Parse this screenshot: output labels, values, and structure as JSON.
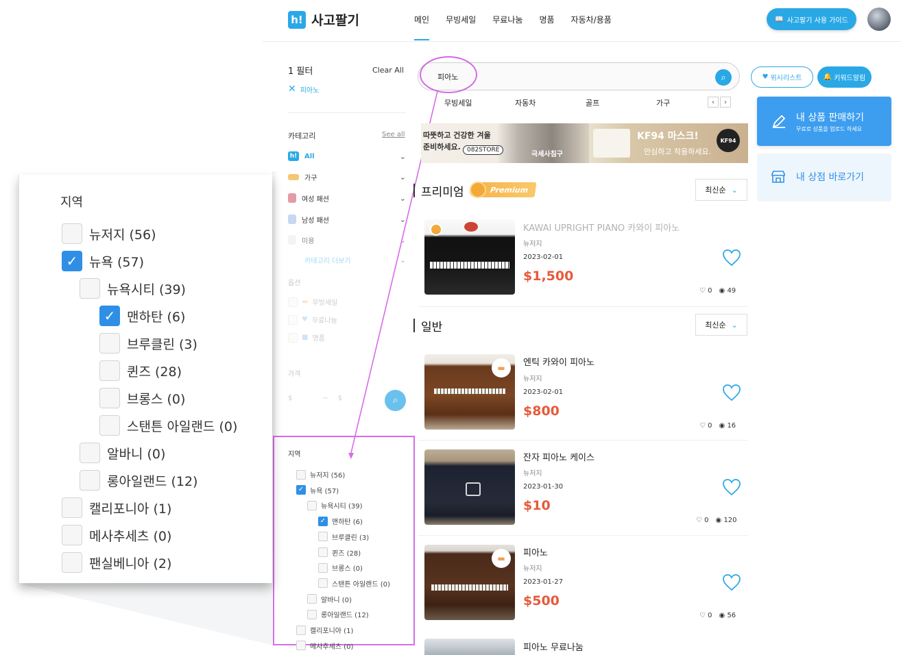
{
  "header": {
    "logo_mark": "h!",
    "logo_text": "사고팔기",
    "nav": [
      "메인",
      "무빙세일",
      "무료나눔",
      "명품",
      "자동차/용품"
    ],
    "guide_button": "사고팔기 사용 가이드",
    "accent": "#2aa8e6"
  },
  "filter": {
    "count_label": "1 필터",
    "clear_all": "Clear All",
    "active_tag": "피아노",
    "category_title": "카테고리",
    "see_all": "See all",
    "categories": [
      "All",
      "가구",
      "여성 패션",
      "남성 패션",
      "미용",
      "카테고리 더보기"
    ],
    "option_title": "옵션",
    "options": [
      "무빙세일",
      "무료나눔",
      "명품"
    ],
    "price_title": "가격",
    "price_min": "$",
    "price_sep": "~",
    "price_max": "$",
    "region_title": "지역",
    "regions": [
      {
        "label": "뉴저지 (56)",
        "checked": false,
        "level": 0
      },
      {
        "label": "뉴욕 (57)",
        "checked": true,
        "level": 0
      },
      {
        "label": "뉴욕시티 (39)",
        "checked": false,
        "level": 1
      },
      {
        "label": "맨하탄 (6)",
        "checked": true,
        "level": 2
      },
      {
        "label": "브루클린 (3)",
        "checked": false,
        "level": 2
      },
      {
        "label": "퀸즈 (28)",
        "checked": false,
        "level": 2
      },
      {
        "label": "브롱스 (0)",
        "checked": false,
        "level": 2
      },
      {
        "label": "스탠튼 아일랜드 (0)",
        "checked": false,
        "level": 2
      },
      {
        "label": "알바니 (0)",
        "checked": false,
        "level": 1
      },
      {
        "label": "롱아일랜드 (12)",
        "checked": false,
        "level": 1
      },
      {
        "label": "캘리포니아 (1)",
        "checked": false,
        "level": 0
      },
      {
        "label": "메사추세츠 (0)",
        "checked": false,
        "level": 0
      },
      {
        "label": "팬실베니아 (2)",
        "checked": false,
        "level": 0
      }
    ]
  },
  "zoom": {
    "title": "지역"
  },
  "search": {
    "value": "피아노",
    "tags": [
      "무빙세일",
      "자동차",
      "골프",
      "가구"
    ]
  },
  "banner": {
    "text1": "따뜻하고 건강한 겨울",
    "text2": "준비하세요.",
    "store": "082STORE",
    "text3": "극세사침구",
    "text4": "KF94 마스크!",
    "text5": "안심하고 착용하세요.",
    "badge": "KF94"
  },
  "side": {
    "wishlist": "위시리스트",
    "keyword_alert": "키워드알림",
    "sell_title": "내 상품 판매하기",
    "sell_sub": "무료로 상품을 업로드 하세요",
    "store_link": "내 상점 바로가기"
  },
  "premium": {
    "title": "프리미엄",
    "badge": "Premium",
    "sort": "최신순",
    "items": [
      {
        "title": "KAWAI UPRIGHT PIANO 카와이 피아노",
        "region": "뉴저지",
        "date": "2023-02-01",
        "price": "$1,500",
        "likes": "0",
        "views": "49"
      }
    ]
  },
  "general": {
    "title": "일반",
    "sort": "최신순",
    "items": [
      {
        "title": "엔틱 카와이 피아노",
        "region": "뉴저지",
        "date": "2023-02-01",
        "price": "$800",
        "likes": "0",
        "views": "16"
      },
      {
        "title": "잔자 피아노 케이스",
        "region": "뉴저지",
        "date": "2023-01-30",
        "price": "$10",
        "likes": "0",
        "views": "120"
      },
      {
        "title": "피아노",
        "region": "뉴저지",
        "date": "2023-01-27",
        "price": "$500",
        "likes": "0",
        "views": "56"
      },
      {
        "title": "피아노 무료나눔"
      }
    ]
  },
  "colors": {
    "accent": "#2aa8e6",
    "price": "#e65a3a",
    "highlight": "#d76ce8",
    "checkbox": "#2f8fe6"
  }
}
